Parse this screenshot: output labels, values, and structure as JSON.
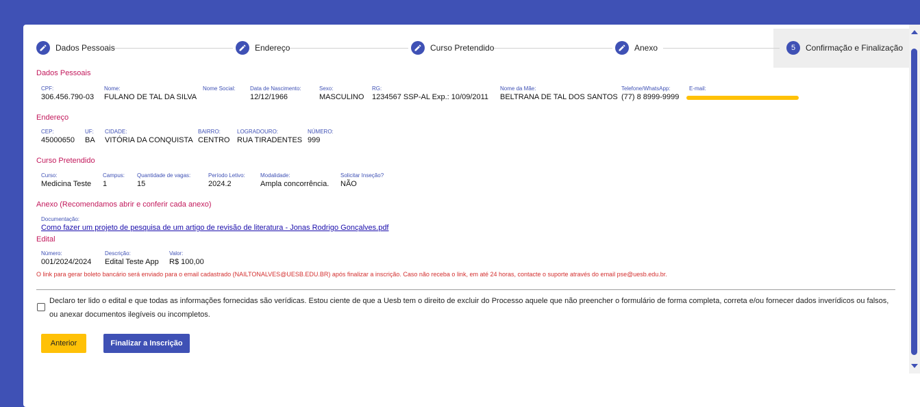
{
  "stepper": {
    "steps": [
      {
        "label": "Dados Pessoais",
        "icon": "pencil-icon"
      },
      {
        "label": "Endereço",
        "icon": "pencil-icon"
      },
      {
        "label": "Curso Pretendido",
        "icon": "pencil-icon"
      },
      {
        "label": "Anexo",
        "icon": "pencil-icon"
      },
      {
        "label": "Confirmação e Finalização",
        "number": "5"
      }
    ]
  },
  "dados_pessoais": {
    "title": "Dados Pessoais",
    "fields": [
      {
        "label": "CPF:",
        "value": "306.456.790-03"
      },
      {
        "label": "Nome:",
        "value": "FULANO DE TAL DA SILVA"
      },
      {
        "label": "Nome Social:",
        "value": ""
      },
      {
        "label": "Data de Nascimento:",
        "value": "12/12/1966"
      },
      {
        "label": "Sexo:",
        "value": "MASCULINO"
      },
      {
        "label": "RG:",
        "value": "1234567 SSP-AL Exp.: 10/09/2011"
      },
      {
        "label": "Nome da Mãe:",
        "value": "BELTRANA DE TAL DOS SANTOS"
      },
      {
        "label": "Telefone/WhatsApp:",
        "value": "(77) 8 8999-9999"
      },
      {
        "label": "E-mail:",
        "value": ""
      }
    ]
  },
  "endereco": {
    "title": "Endereço",
    "fields": [
      {
        "label": "CEP:",
        "value": "45000650"
      },
      {
        "label": "UF:",
        "value": "BA"
      },
      {
        "label": "CIDADE:",
        "value": "VITÓRIA DA CONQUISTA"
      },
      {
        "label": "BAIRRO:",
        "value": "CENTRO"
      },
      {
        "label": "LOGRADOURO:",
        "value": "RUA TIRADENTES"
      },
      {
        "label": "NÚMERO:",
        "value": "999"
      }
    ]
  },
  "curso": {
    "title": "Curso Pretendido",
    "fields": [
      {
        "label": "Curso:",
        "value": "Medicina Teste"
      },
      {
        "label": "Campus:",
        "value": "1"
      },
      {
        "label": "Quantidade de vagas:",
        "value": "15"
      },
      {
        "label": "Período Letivo:",
        "value": "2024.2"
      },
      {
        "label": "Modalidade:",
        "value": "Ampla concorrência."
      },
      {
        "label": "Solicitar Inseção?",
        "value": "NÃO"
      }
    ]
  },
  "anexo": {
    "title": "Anexo (Recomendamos abrir e conferir cada anexo)",
    "doc_label": "Documentação:",
    "doc_link": "Como fazer um projeto de pesquisa de um artigo de revisão de literatura - Jonas Rodrigo Gonçalves.pdf"
  },
  "edital": {
    "title": "Edital",
    "fields": [
      {
        "label": "Número:",
        "value": "001/2024/2024"
      },
      {
        "label": "Descrição:",
        "value": "Edital Teste App"
      },
      {
        "label": "Valor:",
        "value": "R$ 100,00"
      }
    ]
  },
  "notice": "O link para gerar boleto bancário será enviado para o email cadastrado (NAILTONALVES@UESB.EDU.BR) após finalizar a inscrição. Caso não receba o link, em até 24 horas, contacte o suporte através do email pse@uesb.edu.br.",
  "declaration": "Declaro ter lido o edital e que todas as informações fornecidas são verídicas. Estou ciente de que a Uesb tem o direito de excluir do Processo aquele que não preencher o formulário de forma completa, correta e/ou fornecer dados inverídicos ou falsos, ou anexar documentos ilegíveis ou incompletos.",
  "buttons": {
    "previous": "Anterior",
    "finish": "Finalizar a Inscrição"
  },
  "colors": {
    "primary": "#3f51b5",
    "section_title": "#c2185b",
    "notice": "#d32f2f",
    "accent": "#ffc107"
  }
}
